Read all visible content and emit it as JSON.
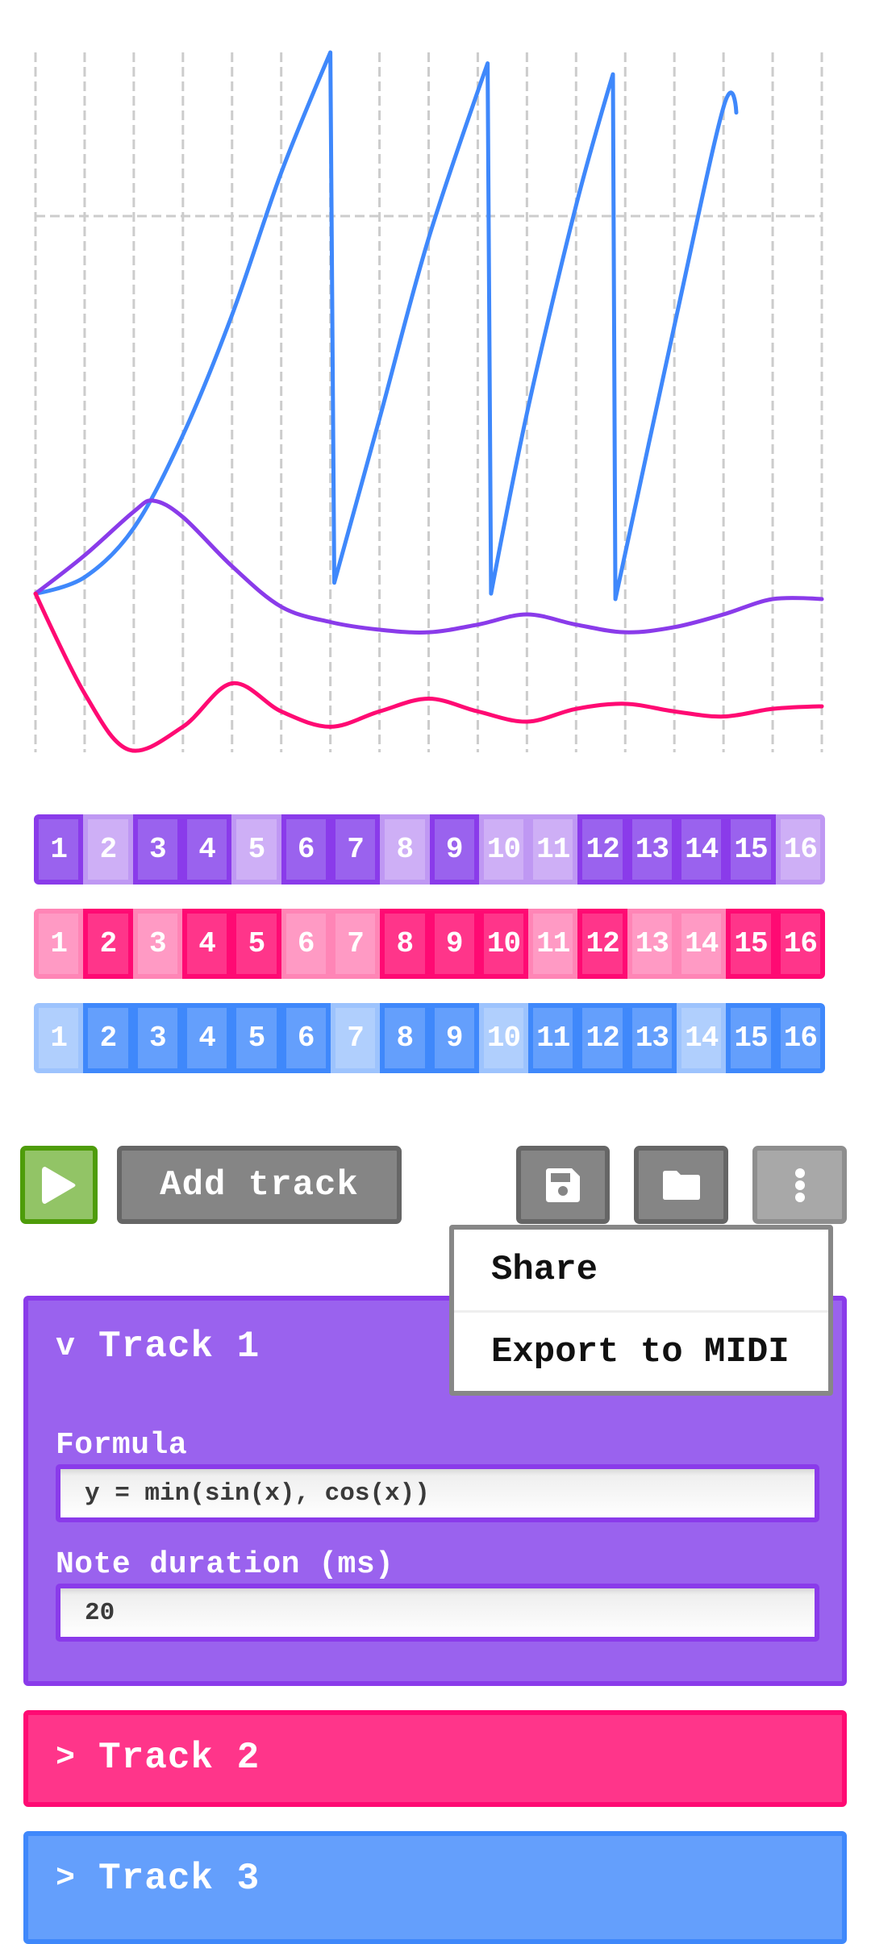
{
  "chart_data": {
    "type": "line",
    "title": "",
    "xlabel": "",
    "ylabel": "",
    "grid": true,
    "x_gridlines": 17,
    "y_gridlines": 2,
    "xlim": [
      0,
      16
    ],
    "ylim": [
      -1,
      1
    ],
    "note": "Waveform preview; values estimated as normalized y (1 = top of plot, -1 = bottom), x in step units 0-16",
    "series": [
      {
        "name": "Track 3",
        "color": "#3f88fb",
        "points": [
          [
            0,
            0.01
          ],
          [
            1,
            0.04
          ],
          [
            2,
            0.13
          ],
          [
            3,
            0.3
          ],
          [
            4,
            0.52
          ],
          [
            5,
            0.78
          ],
          [
            6,
            1.0
          ],
          [
            6.08,
            0.03
          ],
          [
            7,
            0.33
          ],
          [
            8,
            0.66
          ],
          [
            9.2,
            0.98
          ],
          [
            9.27,
            0.01
          ],
          [
            10,
            0.34
          ],
          [
            11,
            0.72
          ],
          [
            11.75,
            0.96
          ],
          [
            11.8,
            0.0
          ],
          [
            13,
            0.5
          ],
          [
            14,
            0.9
          ],
          [
            14.26,
            0.89
          ]
        ]
      },
      {
        "name": "Track 1",
        "color": "#8a3bea",
        "points": [
          [
            0,
            0.01
          ],
          [
            1,
            0.08
          ],
          [
            2,
            0.16
          ],
          [
            2.4,
            0.18
          ],
          [
            3,
            0.15
          ],
          [
            4,
            0.06
          ],
          [
            5,
            -0.03
          ],
          [
            6,
            -0.09
          ],
          [
            7,
            -0.12
          ],
          [
            8,
            -0.13
          ],
          [
            9,
            -0.1
          ],
          [
            10,
            -0.06
          ],
          [
            11,
            -0.1
          ],
          [
            12,
            -0.13
          ],
          [
            13,
            -0.11
          ],
          [
            14,
            -0.06
          ],
          [
            15,
            0.0
          ],
          [
            16,
            0.0
          ]
        ]
      },
      {
        "name": "Track 2",
        "color": "#ff0a73",
        "points": [
          [
            0,
            0.01
          ],
          [
            1,
            -0.37
          ],
          [
            1.9,
            -0.59
          ],
          [
            3,
            -0.5
          ],
          [
            4,
            -0.33
          ],
          [
            5,
            -0.44
          ],
          [
            6,
            -0.5
          ],
          [
            7,
            -0.44
          ],
          [
            8,
            -0.39
          ],
          [
            9,
            -0.44
          ],
          [
            10,
            -0.48
          ],
          [
            11,
            -0.43
          ],
          [
            12,
            -0.41
          ],
          [
            13,
            -0.44
          ],
          [
            14,
            -0.46
          ],
          [
            15,
            -0.43
          ],
          [
            16,
            -0.42
          ]
        ]
      }
    ]
  },
  "tracks": [
    {
      "name": "Track 1",
      "expanded": true,
      "color": "#8a3bea",
      "fill": "#9a62ee",
      "inactive_border": "#bf98f3",
      "inactive_fill": "#ceaff6",
      "steps": [
        true,
        false,
        true,
        true,
        false,
        true,
        true,
        false,
        true,
        false,
        false,
        true,
        true,
        true,
        true,
        false
      ],
      "step_labels": [
        "1",
        "2",
        "3",
        "4",
        "5",
        "6",
        "7",
        "8",
        "9",
        "10",
        "11",
        "12",
        "13",
        "14",
        "15",
        "16"
      ]
    },
    {
      "name": "Track 2",
      "expanded": false,
      "color": "#ff0a73",
      "fill": "#ff358a",
      "inactive_border": "#ff85b6",
      "inactive_fill": "#ff9ac4",
      "steps": [
        false,
        true,
        false,
        true,
        true,
        false,
        false,
        true,
        true,
        true,
        false,
        true,
        false,
        false,
        true,
        true
      ],
      "step_labels": [
        "1",
        "2",
        "3",
        "4",
        "5",
        "6",
        "7",
        "8",
        "9",
        "10",
        "11",
        "12",
        "13",
        "14",
        "15",
        "16"
      ]
    },
    {
      "name": "Track 3",
      "expanded": false,
      "color": "#3f88fb",
      "fill": "#649ffc",
      "inactive_border": "#9dc3fd",
      "inactive_fill": "#b0cffd",
      "steps": [
        false,
        true,
        true,
        true,
        true,
        true,
        false,
        true,
        true,
        false,
        true,
        true,
        true,
        false,
        true,
        true
      ],
      "step_labels": [
        "1",
        "2",
        "3",
        "4",
        "5",
        "6",
        "7",
        "8",
        "9",
        "10",
        "11",
        "12",
        "13",
        "14",
        "15",
        "16"
      ]
    }
  ],
  "toolbar": {
    "play_icon": "play-icon",
    "add_track_label": "Add track",
    "save_icon": "floppy-disk-icon",
    "open_icon": "folder-icon",
    "menu_icon": "vertical-ellipsis-icon"
  },
  "menu": {
    "open": true,
    "items": [
      "Share",
      "Export to MIDI"
    ]
  },
  "track_panels": [
    {
      "chevron": "v",
      "title": "Track 1",
      "formula_label": "Formula",
      "formula_value": "y = min(sin(x), cos(x))",
      "duration_label": "Note duration (ms)",
      "duration_value": "20"
    },
    {
      "chevron": ">",
      "title": "Track 2"
    },
    {
      "chevron": ">",
      "title": "Track 3"
    }
  ]
}
